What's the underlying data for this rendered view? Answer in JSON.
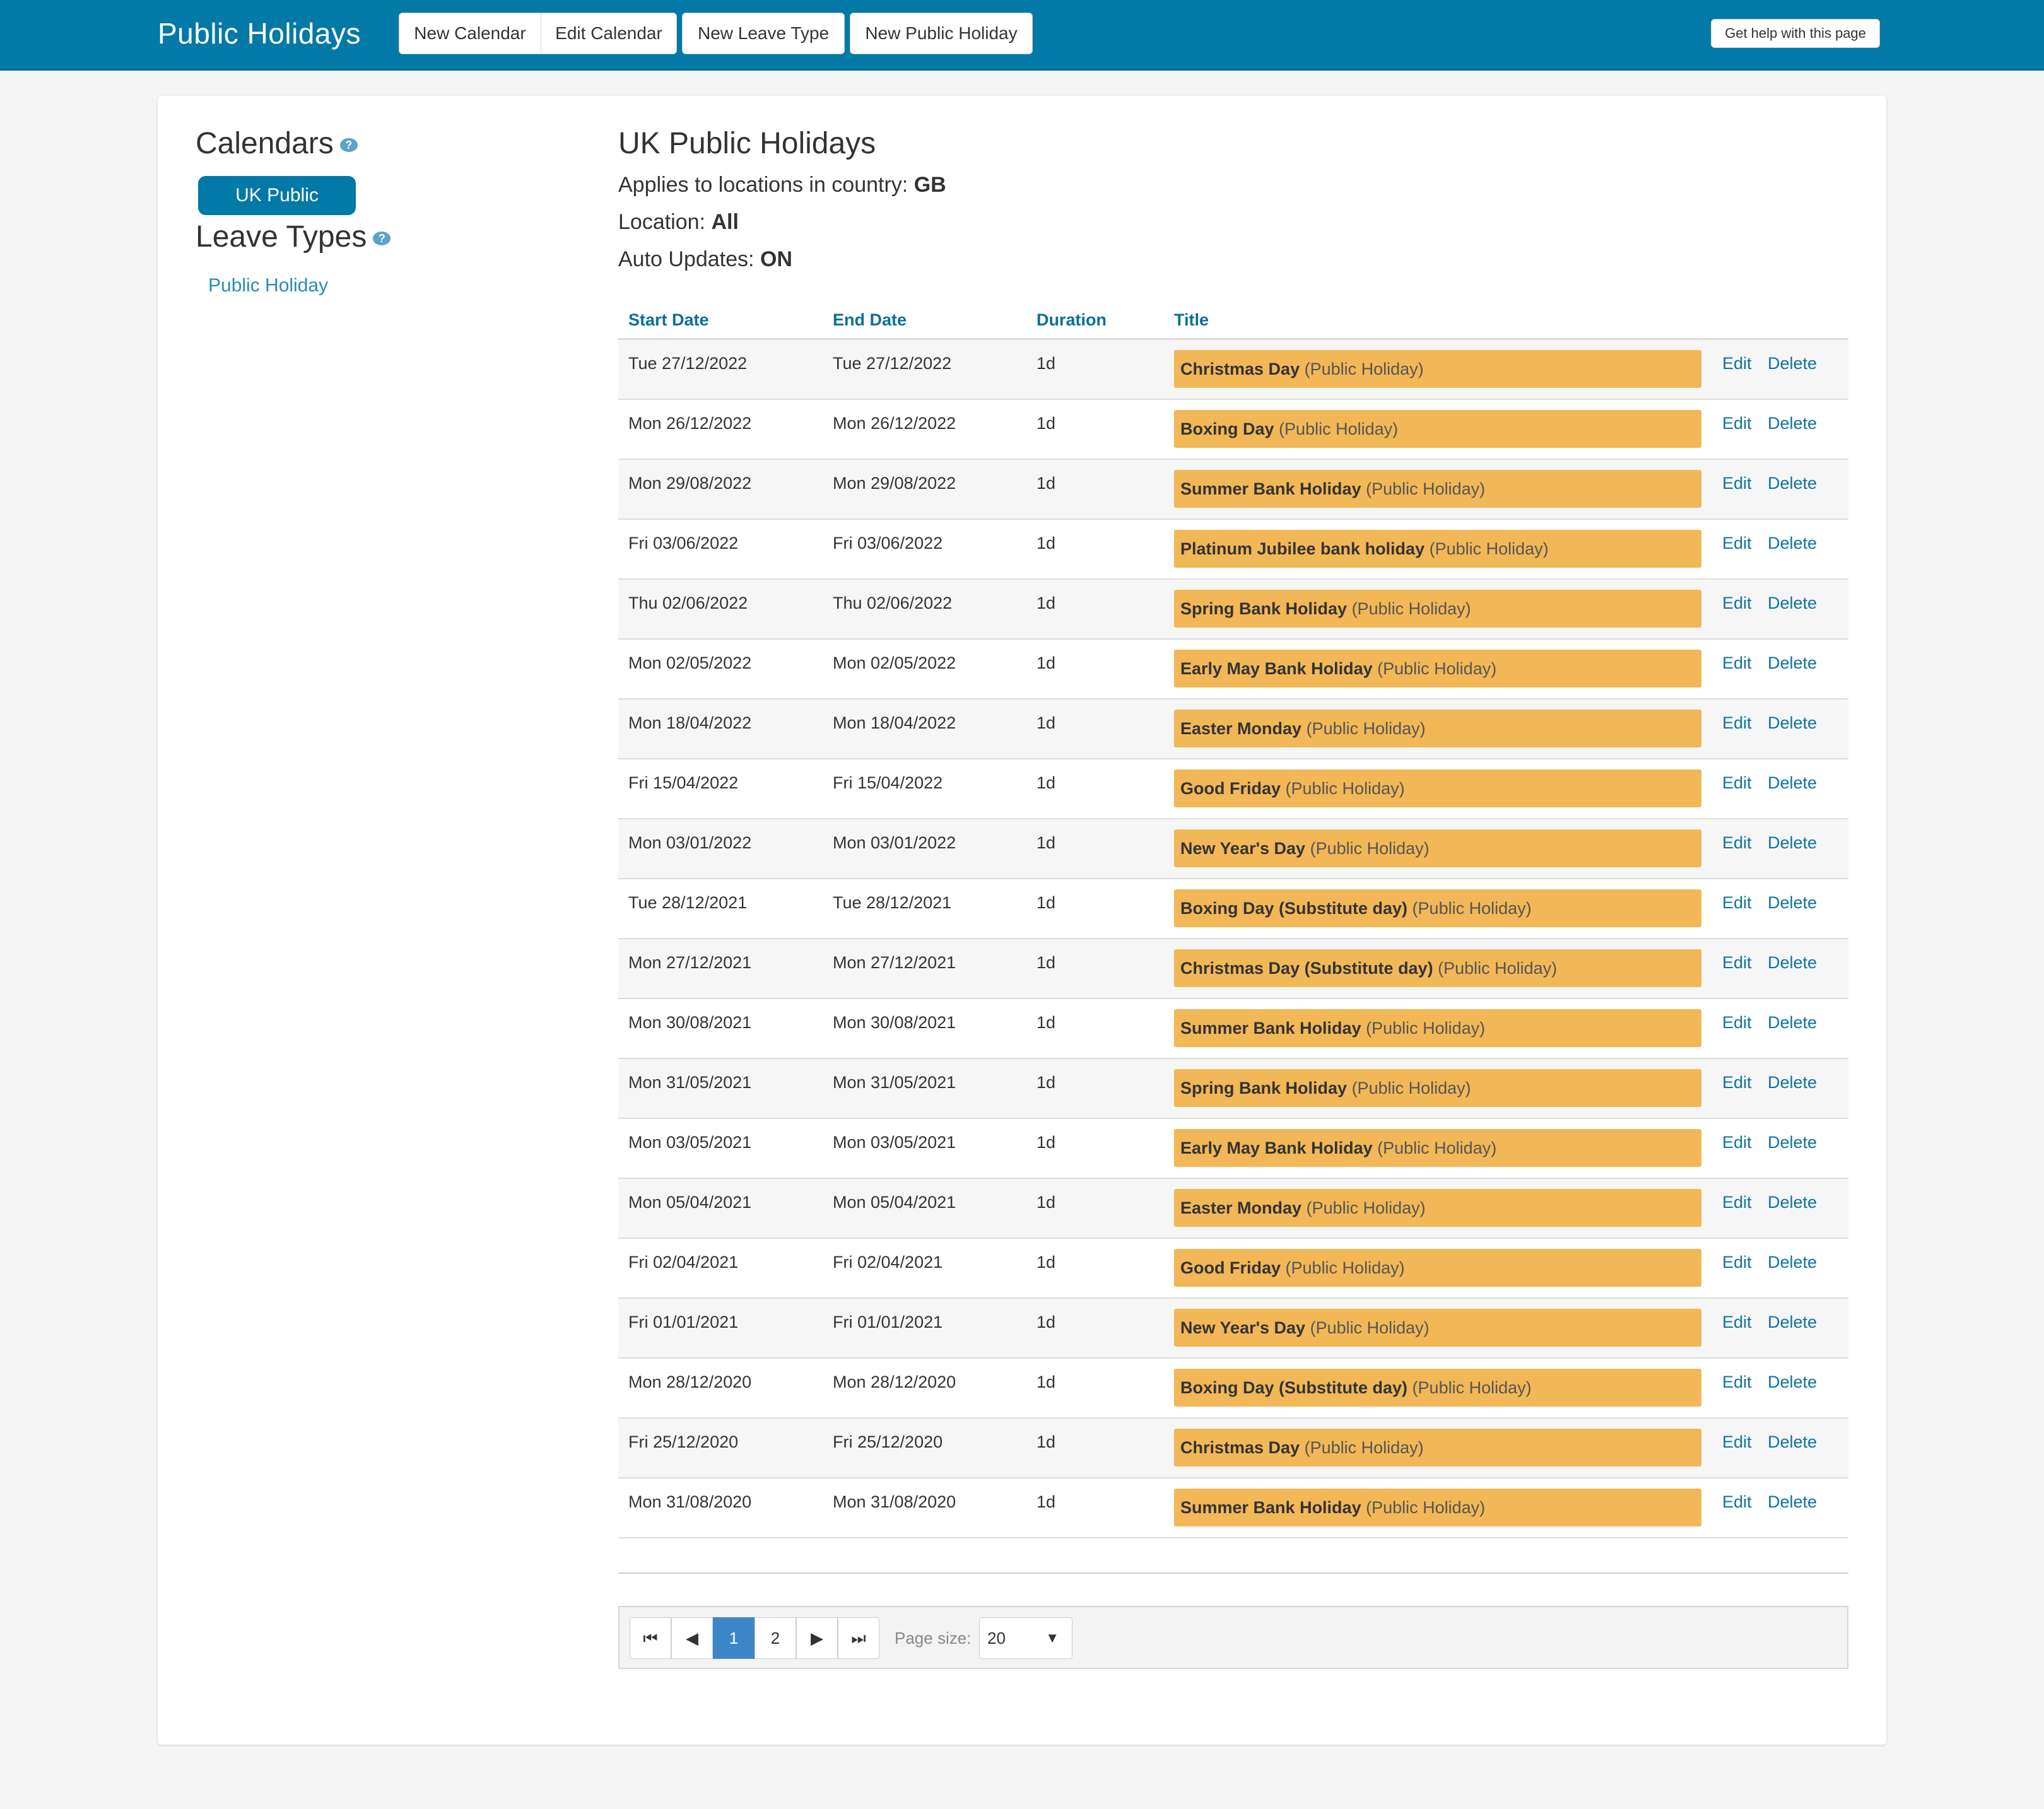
{
  "header": {
    "title": "Public Holidays",
    "buttons": {
      "new_calendar": "New Calendar",
      "edit_calendar": "Edit Calendar",
      "new_leave_type": "New Leave Type",
      "new_public_holiday": "New Public Holiday"
    },
    "help": "Get help with this page"
  },
  "sidebar": {
    "calendars_title": "Calendars",
    "calendar_item": "UK Public Holidays",
    "leave_types_title": "Leave Types",
    "leave_type_item": "Public Holiday",
    "help_icon": "?"
  },
  "main": {
    "title": "UK Public Holidays",
    "country_label": "Applies to locations in country:",
    "country_value": "GB",
    "location_label": "Location:",
    "location_value": "All",
    "auto_label": "Auto Updates:",
    "auto_value": "ON"
  },
  "table": {
    "columns": {
      "start": "Start Date",
      "end": "End Date",
      "duration": "Duration",
      "title": "Title"
    },
    "edit_label": "Edit",
    "delete_label": "Delete",
    "rows": [
      {
        "start": "Tue 27/12/2022",
        "end": "Tue 27/12/2022",
        "duration": "1d",
        "name": "Christmas Day",
        "type": "(Public Holiday)"
      },
      {
        "start": "Mon 26/12/2022",
        "end": "Mon 26/12/2022",
        "duration": "1d",
        "name": "Boxing Day",
        "type": "(Public Holiday)"
      },
      {
        "start": "Mon 29/08/2022",
        "end": "Mon 29/08/2022",
        "duration": "1d",
        "name": "Summer Bank Holiday",
        "type": "(Public Holiday)"
      },
      {
        "start": "Fri 03/06/2022",
        "end": "Fri 03/06/2022",
        "duration": "1d",
        "name": "Platinum Jubilee bank holiday",
        "type": "(Public Holiday)"
      },
      {
        "start": "Thu 02/06/2022",
        "end": "Thu 02/06/2022",
        "duration": "1d",
        "name": "Spring Bank Holiday",
        "type": "(Public Holiday)"
      },
      {
        "start": "Mon 02/05/2022",
        "end": "Mon 02/05/2022",
        "duration": "1d",
        "name": "Early May Bank Holiday",
        "type": "(Public Holiday)"
      },
      {
        "start": "Mon 18/04/2022",
        "end": "Mon 18/04/2022",
        "duration": "1d",
        "name": "Easter Monday",
        "type": "(Public Holiday)"
      },
      {
        "start": "Fri 15/04/2022",
        "end": "Fri 15/04/2022",
        "duration": "1d",
        "name": "Good Friday",
        "type": "(Public Holiday)"
      },
      {
        "start": "Mon 03/01/2022",
        "end": "Mon 03/01/2022",
        "duration": "1d",
        "name": "New Year's Day",
        "type": "(Public Holiday)"
      },
      {
        "start": "Tue 28/12/2021",
        "end": "Tue 28/12/2021",
        "duration": "1d",
        "name": "Boxing Day (Substitute day)",
        "type": "(Public Holiday)"
      },
      {
        "start": "Mon 27/12/2021",
        "end": "Mon 27/12/2021",
        "duration": "1d",
        "name": "Christmas Day (Substitute day)",
        "type": "(Public Holiday)"
      },
      {
        "start": "Mon 30/08/2021",
        "end": "Mon 30/08/2021",
        "duration": "1d",
        "name": "Summer Bank Holiday",
        "type": "(Public Holiday)"
      },
      {
        "start": "Mon 31/05/2021",
        "end": "Mon 31/05/2021",
        "duration": "1d",
        "name": "Spring Bank Holiday",
        "type": "(Public Holiday)"
      },
      {
        "start": "Mon 03/05/2021",
        "end": "Mon 03/05/2021",
        "duration": "1d",
        "name": "Early May Bank Holiday",
        "type": "(Public Holiday)"
      },
      {
        "start": "Mon 05/04/2021",
        "end": "Mon 05/04/2021",
        "duration": "1d",
        "name": "Easter Monday",
        "type": "(Public Holiday)"
      },
      {
        "start": "Fri 02/04/2021",
        "end": "Fri 02/04/2021",
        "duration": "1d",
        "name": "Good Friday",
        "type": "(Public Holiday)"
      },
      {
        "start": "Fri 01/01/2021",
        "end": "Fri 01/01/2021",
        "duration": "1d",
        "name": "New Year's Day",
        "type": "(Public Holiday)"
      },
      {
        "start": "Mon 28/12/2020",
        "end": "Mon 28/12/2020",
        "duration": "1d",
        "name": "Boxing Day (Substitute day)",
        "type": "(Public Holiday)"
      },
      {
        "start": "Fri 25/12/2020",
        "end": "Fri 25/12/2020",
        "duration": "1d",
        "name": "Christmas Day",
        "type": "(Public Holiday)"
      },
      {
        "start": "Mon 31/08/2020",
        "end": "Mon 31/08/2020",
        "duration": "1d",
        "name": "Summer Bank Holiday",
        "type": "(Public Holiday)"
      }
    ]
  },
  "pager": {
    "first": "⏮",
    "prev": "◀",
    "pages": [
      "1",
      "2"
    ],
    "current": "1",
    "next": "▶",
    "last": "⏭",
    "page_size_label": "Page size:",
    "page_size_value": "20",
    "caret": "▼"
  },
  "colors": {
    "brand": "#0279a6",
    "tag": "#f2b756",
    "link": "#0e73a0"
  }
}
